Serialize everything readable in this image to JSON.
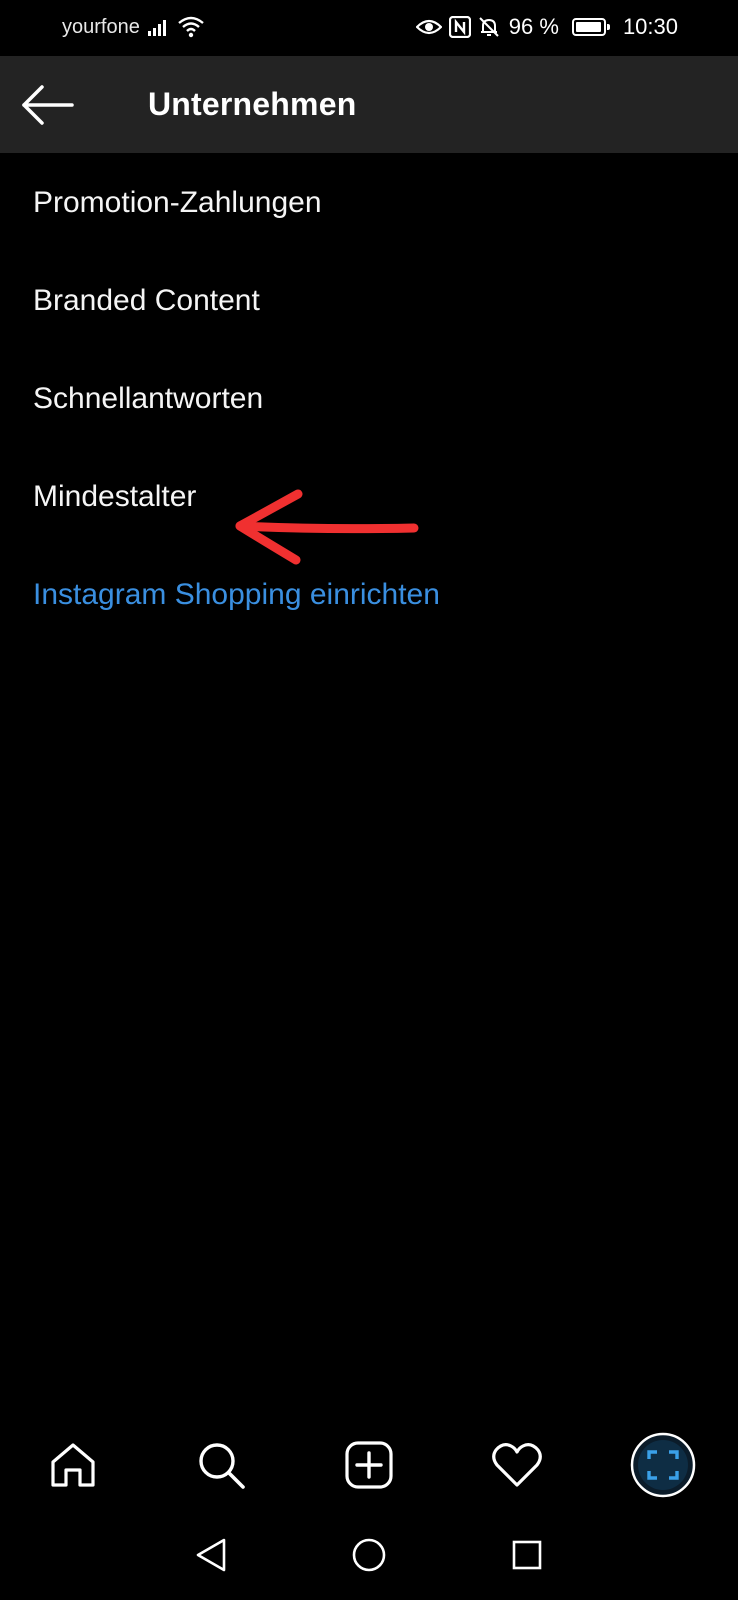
{
  "status_bar": {
    "carrier": "yourfone",
    "battery_percent": "96 %",
    "battery_level": 0.96,
    "time": "10:30",
    "icons": [
      "signal-icon",
      "wifi-icon",
      "eye-icon",
      "nfc-icon",
      "bell-off-icon",
      "battery-icon"
    ]
  },
  "header": {
    "title": "Unternehmen",
    "back_icon": "arrow-left-icon"
  },
  "menu": {
    "items": [
      {
        "label": "Promotion-Zahlungen"
      },
      {
        "label": "Branded Content"
      },
      {
        "label": "Schnellantworten"
      },
      {
        "label": "Mindestalter"
      },
      {
        "label": "Instagram Shopping einrichten",
        "color": "#3a8fe0"
      }
    ]
  },
  "annotation": {
    "icon": "red-arrow-icon",
    "color": "#f03030"
  },
  "bottom_nav": {
    "items": [
      "home-icon",
      "search-icon",
      "add-post-icon",
      "heart-icon",
      "profile-avatar-icon"
    ]
  },
  "system_nav": {
    "items": [
      "back-triangle-icon",
      "home-circle-icon",
      "recents-square-icon"
    ]
  },
  "colors": {
    "background": "#000000",
    "app_bar": "#232323",
    "link": "#3a8fe0",
    "annotation": "#f03030"
  }
}
